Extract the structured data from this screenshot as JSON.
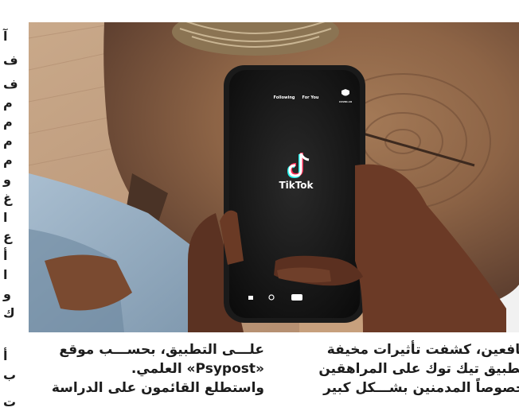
{
  "left_column_fragments": [
    "آ",
    "ف",
    "ف",
    "م",
    "م",
    "م",
    "م",
    "و",
    "غ",
    "ا",
    "ع",
    "أ",
    "ا",
    "و",
    "ك",
    "أ",
    "ب",
    "ت"
  ],
  "photo": {
    "subject": "hand holding phone with TikTok app",
    "phone": {
      "tab_following": "Following",
      "tab_for_you": "For You",
      "logo_label": "TikTok",
      "corner_label": "COVID-19"
    }
  },
  "article": {
    "right_column_lines": [
      "يافعين، كشفت تأثيرات مخيفة",
      "تطبيق تيك توك على المراهقين",
      "خصوصاً المدمنين بشـــكل كبير"
    ],
    "left_column_lines": [
      "علـــى التطبيق، بحســـب موقع",
      "«Psypost» العلمي.",
      "واستطلع القائمون على الدراسة"
    ]
  },
  "colors": {
    "text": "#1c1c1c",
    "wood": "#8a6245",
    "phone_body": "#1a1a1a"
  }
}
